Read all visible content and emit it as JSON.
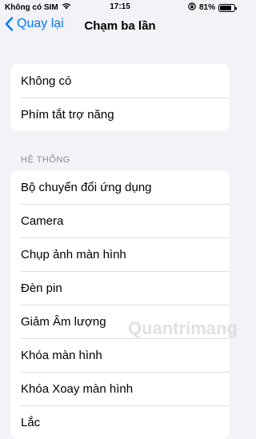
{
  "status_bar": {
    "carrier": "Không có SIM",
    "time": "17:15",
    "battery": "81%",
    "battery_level": 0.81,
    "wifi_icon": "wifi-icon",
    "lock_icon": "orientation-lock-icon"
  },
  "nav": {
    "back_label": "Quay lại",
    "title": "Chạm ba lần"
  },
  "group1": {
    "items": [
      "Không có",
      "Phím tắt trợ năng"
    ]
  },
  "system_section": {
    "header": "HỆ THỐNG",
    "items": [
      "Bộ chuyển đổi ứng dụng",
      "Camera",
      "Chụp ảnh màn hình",
      "Đèn pin",
      "Giảm Âm lượng",
      "Khóa màn hình",
      "Khóa Xoay màn hình",
      "Lắc"
    ]
  },
  "watermark": "Quantrimang",
  "colors": {
    "accent": "#007aff",
    "background": "#f2f2f7",
    "section_header": "#8a8a8e"
  }
}
